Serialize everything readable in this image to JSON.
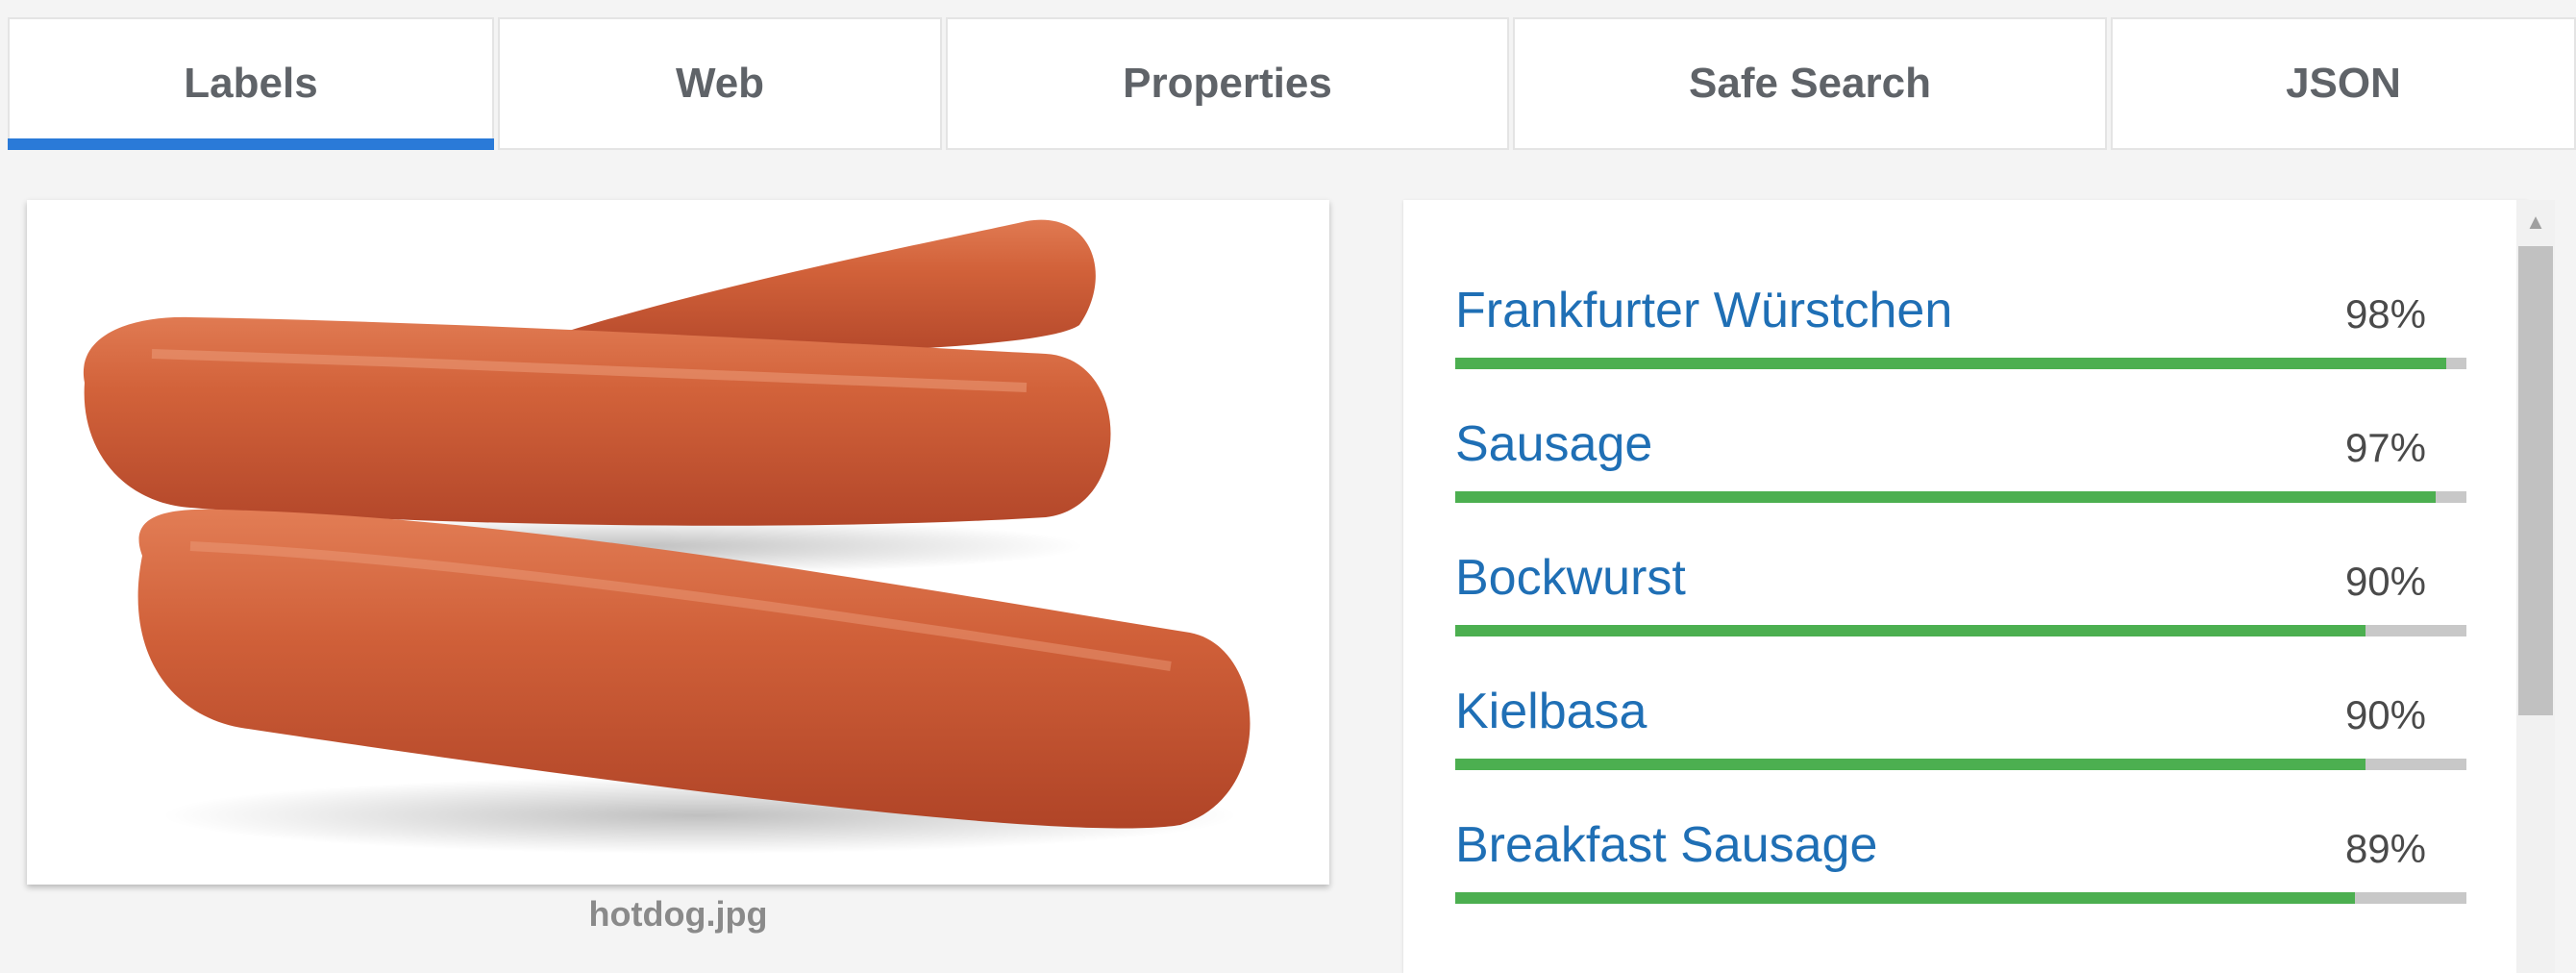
{
  "tabs": [
    {
      "label": "Labels",
      "active": true
    },
    {
      "label": "Web",
      "active": false
    },
    {
      "label": "Properties",
      "active": false
    },
    {
      "label": "Safe Search",
      "active": false
    },
    {
      "label": "JSON",
      "active": false
    }
  ],
  "image": {
    "filename": "hotdog.jpg"
  },
  "labels": [
    {
      "name": "Frankfurter Würstchen",
      "score": "98%",
      "fraction": 0.98
    },
    {
      "name": "Sausage",
      "score": "97%",
      "fraction": 0.97
    },
    {
      "name": "Bockwurst",
      "score": "90%",
      "fraction": 0.9
    },
    {
      "name": "Kielbasa",
      "score": "90%",
      "fraction": 0.9
    },
    {
      "name": "Breakfast Sausage",
      "score": "89%",
      "fraction": 0.89
    }
  ],
  "colors": {
    "accent": "#2a7ad8",
    "label_text": "#1f6fb5",
    "bar_fill": "#4caf50",
    "bar_track": "#c8c8c8"
  }
}
